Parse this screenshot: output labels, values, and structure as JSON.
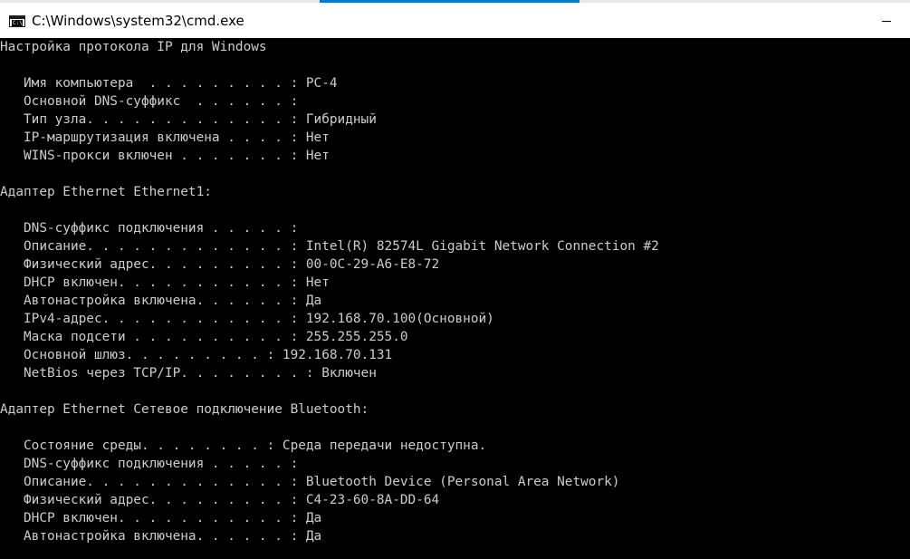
{
  "window": {
    "title": "C:\\Windows\\system32\\cmd.exe",
    "icon": "cmd-console-icon",
    "icon_glyph": "C:\\"
  },
  "console": {
    "background": "#000000",
    "foreground": "#cccccc",
    "lines": [
      "Настройка протокола IP для Windows",
      "",
      "   Имя компьютера  . . . . . . . . . : PC-4",
      "   Основной DNS-суффикс  . . . . . . :",
      "   Тип узла. . . . . . . . . . . . . : Гибридный",
      "   IP-маршрутизация включена . . . . : Нет",
      "   WINS-прокси включен . . . . . . . : Нет",
      "",
      "Адаптер Ethernet Ethernet1:",
      "",
      "   DNS-суффикс подключения . . . . . :",
      "   Описание. . . . . . . . . . . . . : Intel(R) 82574L Gigabit Network Connection #2",
      "   Физический адрес. . . . . . . . . : 00-0C-29-A6-E8-72",
      "   DHCP включен. . . . . . . . . . . : Нет",
      "   Автонастройка включена. . . . . . : Да",
      "   IPv4-адрес. . . . . . . . . . . . : 192.168.70.100(Основной)",
      "   Маска подсети . . . . . . . . . . : 255.255.255.0",
      "   Основной шлюз. . . . . . . . . : 192.168.70.131",
      "   NetBios через TCP/IP. . . . . . . . : Включен",
      "",
      "Адаптер Ethernet Сетевое подключение Bluetooth:",
      "",
      "   Состояние среды. . . . . . . . : Среда передачи недоступна.",
      "   DNS-суффикс подключения . . . . . :",
      "   Описание. . . . . . . . . . . . . : Bluetooth Device (Personal Area Network)",
      "   Физический адрес. . . . . . . . . : C4-23-60-8A-DD-64",
      "   DHCP включен. . . . . . . . . . . : Да",
      "   Автонастройка включена. . . . . . : Да"
    ]
  }
}
